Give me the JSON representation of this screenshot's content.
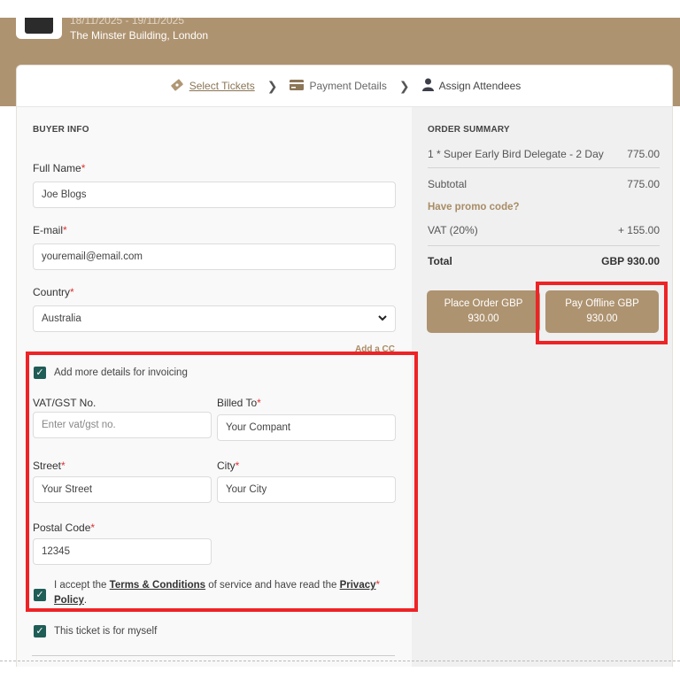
{
  "event": {
    "dates": "18/11/2025 - 19/11/2025",
    "venue": "The Minster Building, London"
  },
  "steps": [
    {
      "label": "Select Tickets",
      "icon": "ticket-icon",
      "active": true
    },
    {
      "label": "Payment Details",
      "icon": "card-icon",
      "active": false
    },
    {
      "label": "Assign Attendees",
      "icon": "person-icon",
      "active": false
    }
  ],
  "buyer": {
    "title": "BUYER INFO",
    "full_name_label": "Full Name",
    "full_name_value": "Joe Blogs",
    "email_label": "E-mail",
    "email_value": "youremail@email.com",
    "country_label": "Country",
    "country_value": "Australia",
    "add_cc": "Add a CC",
    "invoice_checkbox": "Add more details for invoicing",
    "vat_label": "VAT/GST No.",
    "vat_placeholder": "Enter vat/gst no.",
    "billed_label": "Billed To",
    "billed_value": "Your Compant",
    "street_label": "Street",
    "street_value": "Your Street",
    "city_label": "City",
    "city_value": "Your City",
    "postal_label": "Postal Code",
    "postal_value": "12345",
    "terms_pre": "I accept the ",
    "terms_link": "Terms & Conditions",
    "terms_mid": " of service and have read the ",
    "privacy_link1": "Privacy",
    "privacy_link2": "Policy",
    "terms_end": ".",
    "myself_checkbox": "This ticket is for myself"
  },
  "summary": {
    "title": "ORDER SUMMARY",
    "item_label": "1 * Super Early Bird Delegate - 2 Day",
    "item_price": "775.00",
    "subtotal_label": "Subtotal",
    "subtotal_value": "775.00",
    "promo": "Have promo code?",
    "vat_label": "VAT (20%)",
    "vat_value": "+ 155.00",
    "total_label": "Total",
    "total_value": "GBP 930.00",
    "place_order_line1": "Place Order GBP",
    "place_order_line2": "930.00",
    "pay_offline_line1": "Pay Offline GBP",
    "pay_offline_line2": "930.00"
  },
  "colors": {
    "brand": "#ae9370",
    "accent_text": "#a88c64",
    "checkbox": "#1f5d57",
    "required": "#e0312f",
    "highlight": "#ee2326"
  }
}
